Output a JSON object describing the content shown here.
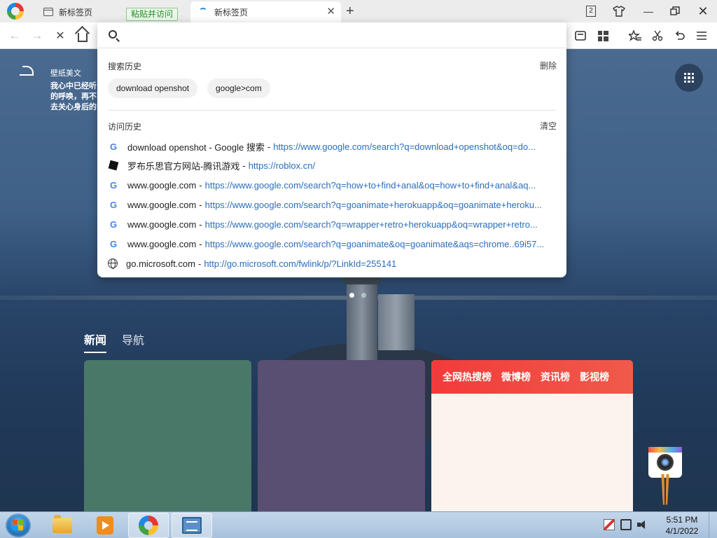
{
  "tabs": [
    {
      "title": "新标签页",
      "active": false
    },
    {
      "title": "新标签页",
      "active": true
    }
  ],
  "paste_visit_label": "粘贴并访问",
  "tab_count": "2",
  "omnibox": {
    "placeholder": "",
    "value": "",
    "search_history_title": "搜索历史",
    "search_history_action": "删除",
    "search_history": [
      "download openshot",
      "google>com"
    ],
    "visit_history_title": "访问历史",
    "visit_history_action": "清空",
    "visit_history": [
      {
        "icon": "google-icon",
        "title": "download openshot - Google 搜索",
        "url": "https://www.google.com/search?q=download+openshot&oq=do..."
      },
      {
        "icon": "roblox-icon",
        "title": "罗布乐思官方网站-腾讯游戏",
        "url": "https://roblox.cn/"
      },
      {
        "icon": "google-icon",
        "title": "www.google.com",
        "url": "https://www.google.com/search?q=how+to+find+anal&oq=how+to+find+anal&aq..."
      },
      {
        "icon": "google-icon",
        "title": "www.google.com",
        "url": "https://www.google.com/search?q=goanimate+herokuapp&oq=goanimate+heroku..."
      },
      {
        "icon": "google-icon",
        "title": "www.google.com",
        "url": "https://www.google.com/search?q=wrapper+retro+herokuapp&oq=wrapper+retro..."
      },
      {
        "icon": "google-icon",
        "title": "www.google.com",
        "url": "https://www.google.com/search?q=goanimate&oq=goanimate&aqs=chrome..69i57..."
      },
      {
        "icon": "globe-icon",
        "title": "go.microsoft.com",
        "url": "http://go.microsoft.com/fwlink/p/?LinkId=255141"
      }
    ]
  },
  "wallpaper": {
    "title": "壁纸美文",
    "lines": [
      "我心中已经听",
      "的呼唤，再不",
      "去关心身后的"
    ]
  },
  "feed_tabs": [
    "新闻",
    "导航"
  ],
  "hot_tabs": [
    "全网热搜榜",
    "微博榜",
    "资讯榜",
    "影视榜"
  ],
  "slide_active": 1,
  "slide_total": 2,
  "clock": {
    "time": "5:51 PM",
    "date": "4/1/2022"
  }
}
